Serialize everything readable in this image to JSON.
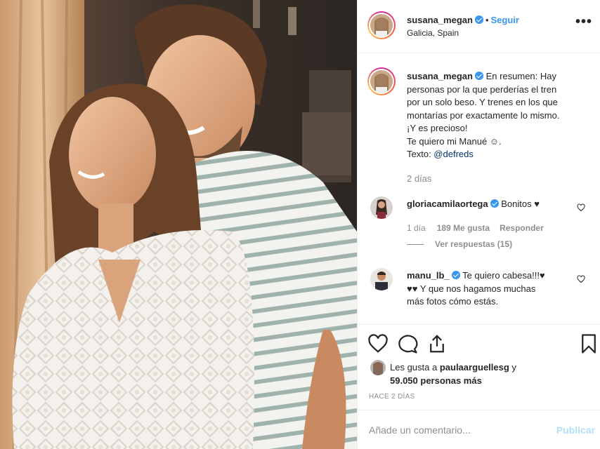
{
  "post": {
    "username": "susana_megan",
    "follow_label": "Seguir",
    "location": "Galicia, Spain",
    "more_label": "•••"
  },
  "caption": {
    "username": "susana_megan",
    "lines": [
      "En resumen: Hay",
      "personas por la que perderías el tren",
      "por un solo beso. Y trenes en los que",
      "montarías por exactamente lo mismo.",
      "¡Y es precioso!",
      "Te quiero mi Manué ☺."
    ],
    "text_prefix": "Texto: ",
    "mention": "@defreds",
    "time": "2 días"
  },
  "comments": [
    {
      "username": "gloriacamilaortega",
      "text": "Bonitos ♥",
      "time": "1 día",
      "likes": "189 Me gusta",
      "reply": "Responder",
      "view_replies": "Ver respuestas (15)"
    },
    {
      "username": "manu_lb_",
      "text_line1": "Te quiero cabesa!!!♥",
      "text_line2": "♥♥ Y que nos hagamos muchas",
      "text_line3": "más fotos cómo estás."
    }
  ],
  "likes": {
    "prefix": "Les gusta a ",
    "user": "paulaarguellesg",
    "suffix": " y",
    "count": "59.050 personas más"
  },
  "posted_ago": "HACE 2 DÍAS",
  "add_comment": {
    "placeholder": "Añade un comentario...",
    "publish_label": "Publicar"
  }
}
